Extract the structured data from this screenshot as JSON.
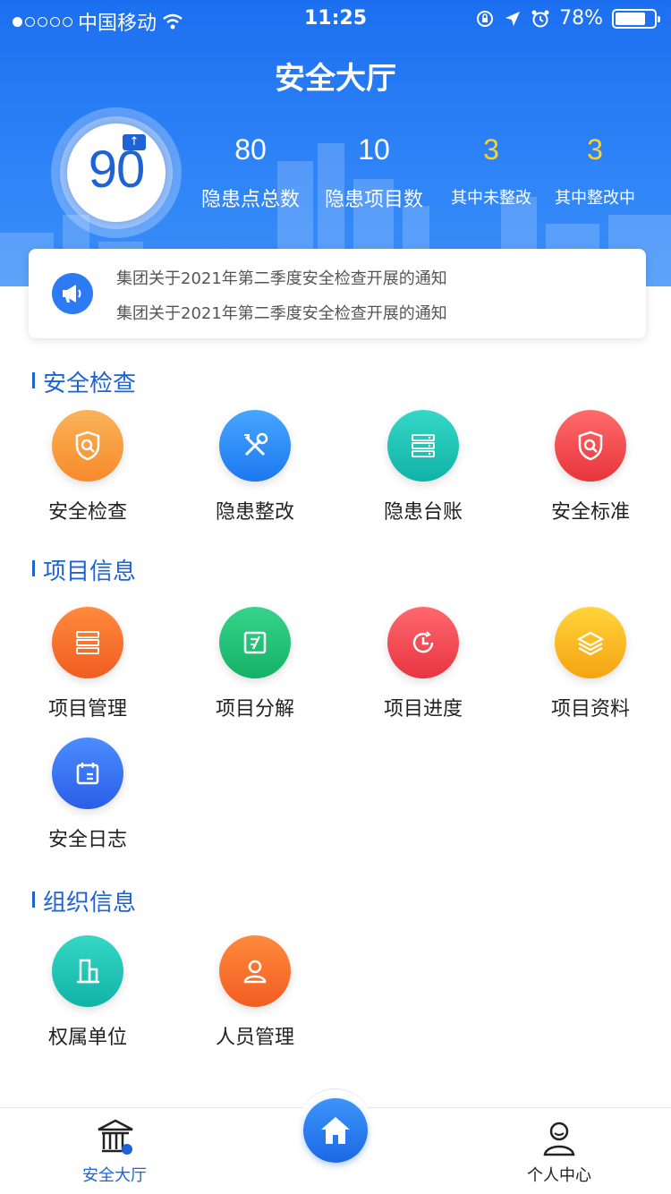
{
  "status_bar": {
    "carrier": "中国移动",
    "time": "11:25",
    "battery": "78%",
    "battery_level": 0.78
  },
  "header": {
    "title": "安全大厅",
    "score": "90",
    "score_badge": "↑",
    "stats": [
      {
        "value": "80",
        "label": "隐患点总数"
      },
      {
        "value": "10",
        "label": "隐患项目数"
      },
      {
        "value": "3",
        "label": "其中未整改"
      },
      {
        "value": "3",
        "label": "其中整改中"
      }
    ]
  },
  "notice": {
    "icon": "megaphone-icon",
    "lines": [
      "集团关于2021年第二季度安全检查开展的通知",
      "集团关于2021年第二季度安全检查开展的通知"
    ]
  },
  "sections": [
    {
      "title": "安全检查",
      "items": [
        {
          "label": "安全检查",
          "icon": "shield-search-icon",
          "color": "#f99a3c"
        },
        {
          "label": "隐患整改",
          "icon": "tools-icon",
          "color": "#2b8ef6"
        },
        {
          "label": "隐患台账",
          "icon": "server-icon",
          "color": "#17c2b4"
        },
        {
          "label": "安全标准",
          "icon": "shield-search-icon",
          "color": "#f04a4a"
        }
      ]
    },
    {
      "title": "项目信息",
      "items": [
        {
          "label": "项目管理",
          "icon": "server-icon",
          "color": "#f6742f"
        },
        {
          "label": "项目分解",
          "icon": "split-doc-icon",
          "color": "#20c37a"
        },
        {
          "label": "项目进度",
          "icon": "clock-icon",
          "color": "#f0444e"
        },
        {
          "label": "项目资料",
          "icon": "layers-icon",
          "color": "#f9b91e"
        },
        {
          "label": "安全日志",
          "icon": "calendar-icon",
          "color": "#3c72f2"
        }
      ]
    },
    {
      "title": "组织信息",
      "items": [
        {
          "label": "权属单位",
          "icon": "building-icon",
          "color": "#17c2b4"
        },
        {
          "label": "人员管理",
          "icon": "person-icon",
          "color": "#f6742f"
        }
      ]
    }
  ],
  "tabbar": {
    "home_label": "安全大厅",
    "me_label": "个人中心",
    "accent": "#1e63d6"
  }
}
